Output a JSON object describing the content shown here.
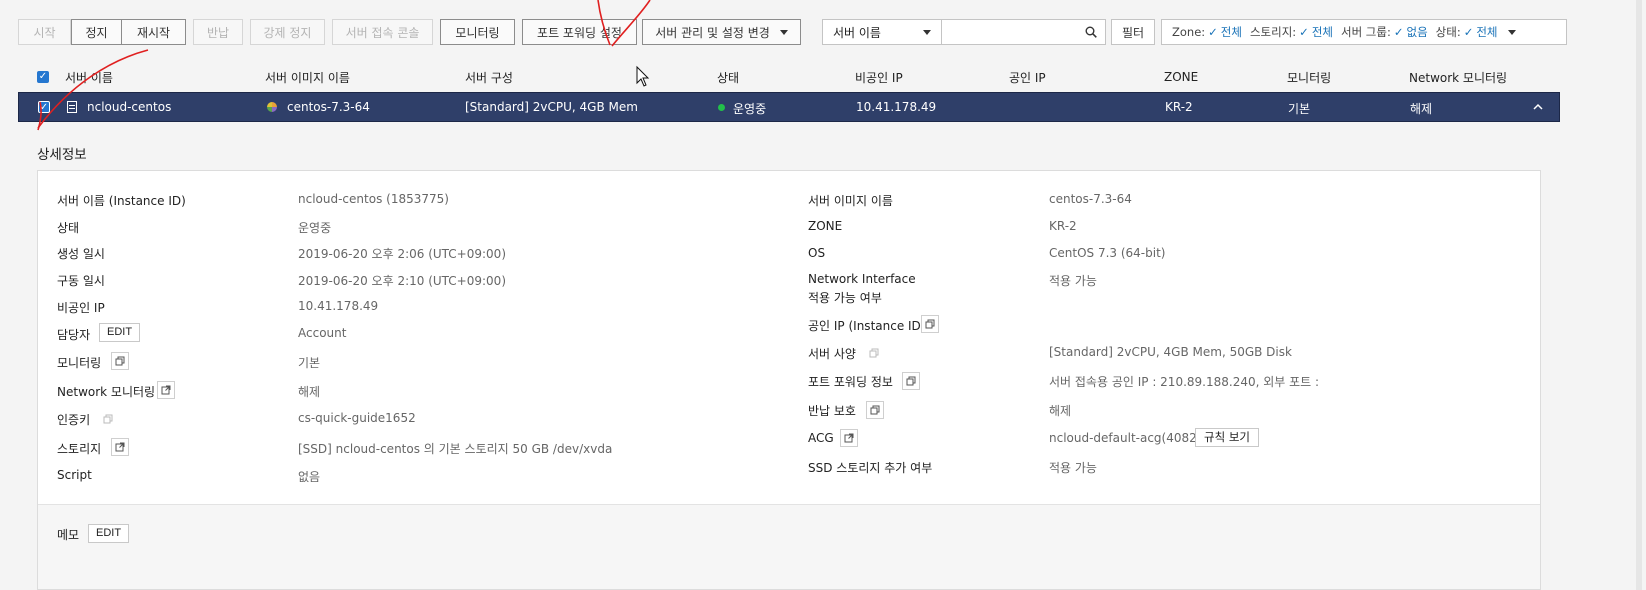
{
  "toolbar": {
    "start": "시작",
    "stop": "정지",
    "restart": "재시작",
    "return": "반납",
    "force_stop": "강제 정지",
    "console": "서버 접속 콘솔",
    "monitoring": "모니터링",
    "port_forwarding": "포트 포워딩 설정",
    "manage": "서버 관리 및 설정 변경"
  },
  "search": {
    "select_value": "서버 이름",
    "placeholder": "",
    "filter_label": "필터"
  },
  "filters": {
    "zone_label": "Zone:",
    "zone_value": "전체",
    "storage_label": "스토리지:",
    "storage_value": "전체",
    "group_label": "서버 그룹:",
    "group_value": "없음",
    "status_label": "상태:",
    "status_value": "전체"
  },
  "table": {
    "headers": [
      "서버 이름",
      "서버 이미지 이름",
      "서버 구성",
      "상태",
      "비공인 IP",
      "공인 IP",
      "ZONE",
      "모니터링",
      "Network 모니터링"
    ],
    "row": {
      "name": "ncloud-centos",
      "image": "centos-7.3-64",
      "spec": "[Standard] 2vCPU, 4GB Mem",
      "status": "운영중",
      "private_ip": "10.41.178.49",
      "public_ip": "",
      "zone": "KR-2",
      "monitoring": "기본",
      "net_monitoring": "해제"
    }
  },
  "detail": {
    "title": "상세정보",
    "left": [
      {
        "label": "서버 이름 (Instance ID)",
        "value": "ncloud-centos (1853775)"
      },
      {
        "label": "상태",
        "value": "운영중"
      },
      {
        "label": "생성 일시",
        "value": "2019-06-20 오후 2:06 (UTC+09:00)"
      },
      {
        "label": "구동 일시",
        "value": "2019-06-20 오후 2:10 (UTC+09:00)"
      },
      {
        "label": "비공인 IP",
        "value": "10.41.178.49"
      },
      {
        "label": "담당자",
        "value": "Account"
      },
      {
        "label": "모니터링",
        "value": "기본"
      },
      {
        "label": "Network 모니터링",
        "value": "해제"
      },
      {
        "label": "인증키",
        "value": "cs-quick-guide1652"
      },
      {
        "label": "스토리지",
        "value": "[SSD] ncloud-centos 의 기본 스토리지  50 GB /dev/xvda"
      },
      {
        "label": "Script",
        "value": "없음"
      }
    ],
    "right": [
      {
        "label": "서버 이미지 이름",
        "value": "centos-7.3-64"
      },
      {
        "label": "ZONE",
        "value": "KR-2"
      },
      {
        "label": "OS",
        "value": "CentOS 7.3 (64-bit)"
      },
      {
        "label": "Network Interface",
        "label2": "적용 가능 여부",
        "value": "적용 가능"
      },
      {
        "label": "공인 IP (Instance ID)",
        "value": ""
      },
      {
        "label": "서버 사양",
        "value": "[Standard] 2vCPU, 4GB Mem, 50GB Disk"
      },
      {
        "label": "포트 포워딩 정보",
        "value": "서버 접속용 공인 IP : 210.89.188.240, 외부 포트 :"
      },
      {
        "label": "반납 보호",
        "value": "해제"
      },
      {
        "label": "ACG",
        "value": "ncloud-default-acg(40829)"
      },
      {
        "label": "SSD 스토리지 추가 여부",
        "value": "적용 가능"
      }
    ],
    "edit_label": "EDIT",
    "rule_button": "규칙 보기",
    "memo_label": "메모"
  }
}
